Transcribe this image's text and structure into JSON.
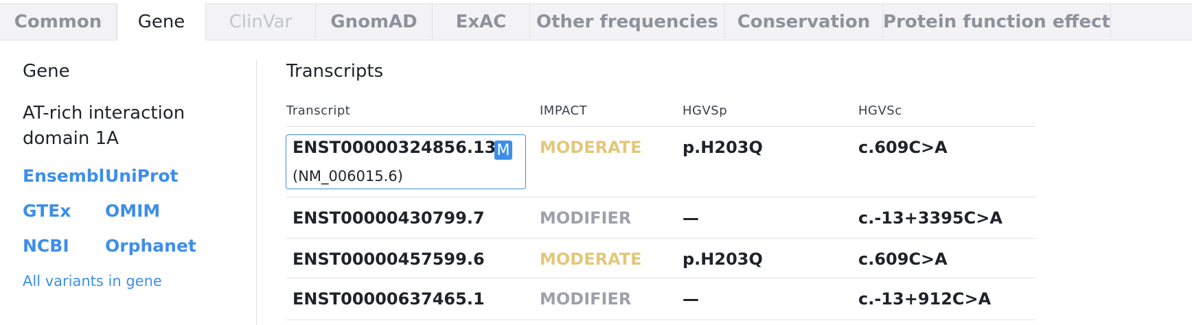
{
  "tabs": [
    {
      "label": "Common",
      "state": "normal"
    },
    {
      "label": "Gene",
      "state": "active"
    },
    {
      "label": "ClinVar",
      "state": "disabled"
    },
    {
      "label": "GnomAD",
      "state": "normal"
    },
    {
      "label": "ExAC",
      "state": "normal"
    },
    {
      "label": "Other frequencies",
      "state": "normal"
    },
    {
      "label": "Conservation",
      "state": "normal"
    },
    {
      "label": "Protein function effect",
      "state": "normal"
    }
  ],
  "gene_panel": {
    "title": "Gene",
    "name": "AT-rich interaction domain 1A",
    "links": [
      "Ensembl",
      "UniProt",
      "GTEx",
      "OMIM",
      "NCBI",
      "Orphanet"
    ],
    "all_variants": "All variants in gene"
  },
  "transcripts": {
    "title": "Transcripts",
    "columns": [
      "Transcript",
      "IMPACT",
      "HGVSp",
      "HGVSc"
    ],
    "mane_badge": "M",
    "rows": [
      {
        "transcript": "ENST00000324856.13",
        "refseq": "(NM_006015.6)",
        "impact": "MODERATE",
        "hgvsp": "p.H203Q",
        "hgvsc": "c.609C>A"
      },
      {
        "transcript": "ENST00000430799.7",
        "impact": "MODIFIER",
        "hgvsp": "—",
        "hgvsc": "c.-13+3395C>A"
      },
      {
        "transcript": "ENST00000457599.6",
        "impact": "MODERATE",
        "hgvsp": "p.H203Q",
        "hgvsc": "c.609C>A"
      },
      {
        "transcript": "ENST00000637465.1",
        "impact": "MODIFIER",
        "hgvsp": "—",
        "hgvsc": "c.-13+912C>A"
      }
    ]
  },
  "colors": {
    "link": "#3d8eea",
    "moderate": "#e3c77a",
    "modifier": "#9ea1ab",
    "tab_bg": "#f3f3f5"
  }
}
